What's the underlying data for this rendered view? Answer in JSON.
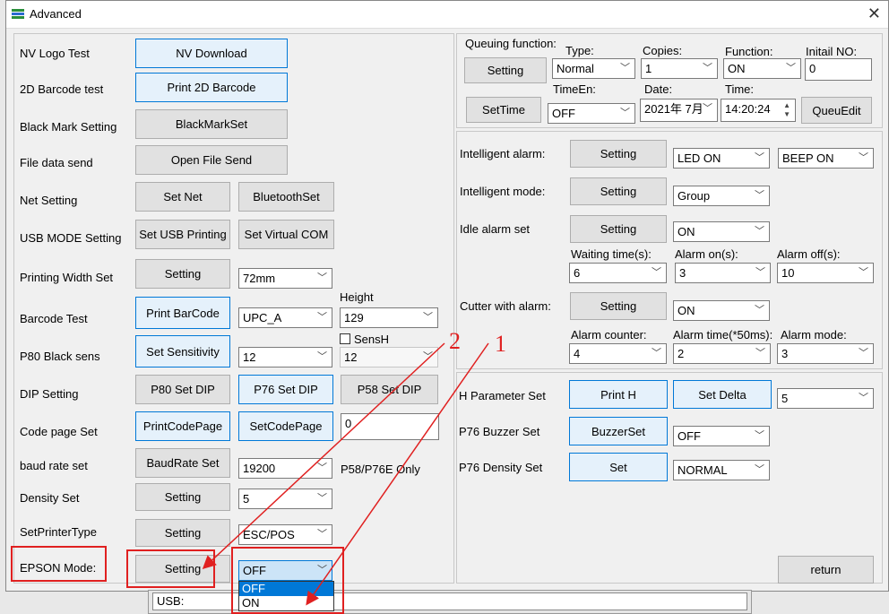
{
  "window": {
    "title": "Advanced"
  },
  "left": {
    "nv_logo": {
      "label": "NV Logo Test",
      "button": "NV Download"
    },
    "barcode2d": {
      "label": "2D Barcode test",
      "button": "Print 2D Barcode"
    },
    "black_mark": {
      "label": "Black Mark Setting",
      "button": "BlackMarkSet"
    },
    "file_send": {
      "label": "File data send",
      "button": "Open File Send"
    },
    "net": {
      "label": "Net Setting",
      "button1": "Set Net",
      "button2": "BluetoothSet"
    },
    "usb_mode": {
      "label": "USB MODE Setting",
      "button1": "Set USB Printing",
      "button2": "Set Virtual COM"
    },
    "print_width": {
      "label": "Printing Width Set",
      "button": "Setting",
      "value": "72mm"
    },
    "barcode_test": {
      "label": "Barcode Test",
      "button": "Print BarCode",
      "type_value": "UPC_A",
      "height_label": "Height",
      "height_value": "129"
    },
    "p80_black": {
      "label": "P80 Black sens",
      "button": "Set Sensitivity",
      "value": "12",
      "sensh_label": "SensH",
      "sensh_value": "12"
    },
    "dip": {
      "label": "DIP Setting",
      "button1": "P80 Set DIP",
      "button2": "P76 Set DIP",
      "button3": "P58 Set DIP"
    },
    "code_page": {
      "label": "Code page Set",
      "button1": "PrintCodePage",
      "button2": "SetCodePage",
      "value": "0"
    },
    "baud": {
      "label": "baud rate set",
      "button": "BaudRate Set",
      "value": "19200",
      "note": "P58/P76E Only"
    },
    "density": {
      "label": "Density Set",
      "button": "Setting",
      "value": "5"
    },
    "printer_type": {
      "label": "SetPrinterType",
      "button": "Setting",
      "value": "ESC/POS"
    },
    "epson": {
      "label": "EPSON Mode:",
      "button": "Setting",
      "value": "OFF",
      "options": [
        "OFF",
        "ON"
      ]
    }
  },
  "queue": {
    "title": "Queuing function:",
    "setting_button": "Setting",
    "settime_button": "SetTime",
    "type_label": "Type:",
    "type_value": "Normal",
    "copies_label": "Copies:",
    "copies_value": "1",
    "function_label": "Function:",
    "function_value": "ON",
    "initial_label": "Initail NO:",
    "initial_value": "0",
    "timeen_label": "TimeEn:",
    "timeen_value": "OFF",
    "date_label": "Date:",
    "date_value": "2021年  7月",
    "time_label": "Time:",
    "time_value": "14:20:24",
    "queuedit_button": "QueuEdit"
  },
  "alarm": {
    "intelligent_alarm": {
      "label": "Intelligent alarm:",
      "button": "Setting",
      "led": "LED ON",
      "beep": "BEEP ON"
    },
    "intelligent_mode": {
      "label": "Intelligent mode:",
      "button": "Setting",
      "value": "Group"
    },
    "idle_alarm": {
      "label": "Idle alarm set",
      "button": "Setting",
      "value": "ON",
      "waiting_label": "Waiting time(s):",
      "waiting_value": "6",
      "on_label": "Alarm on(s):",
      "on_value": "3",
      "off_label": "Alarm off(s):",
      "off_value": "10"
    },
    "cutter": {
      "label": "Cutter with alarm:",
      "button": "Setting",
      "value": "ON",
      "counter_label": "Alarm counter:",
      "counter_value": "4",
      "time_label": "Alarm time(*50ms):",
      "time_value": "2",
      "mode_label": "Alarm mode:",
      "mode_value": "3"
    }
  },
  "hparam": {
    "h_param": {
      "label": "H Parameter Set",
      "button1": "Print H",
      "button2": "Set Delta",
      "value": "5"
    },
    "buzzer": {
      "label": "P76 Buzzer Set",
      "button": "BuzzerSet",
      "value": "OFF"
    },
    "density": {
      "label": "P76 Density Set",
      "button": "Set",
      "value": "NORMAL"
    },
    "return_button": "return"
  },
  "status": {
    "usb_text": "USB:"
  },
  "annotations": {
    "num1": "1",
    "num2": "2"
  },
  "colors": {
    "highlight_border": "#0078d7",
    "annotation_red": "#e02020",
    "selection_blue": "#0078d7"
  }
}
